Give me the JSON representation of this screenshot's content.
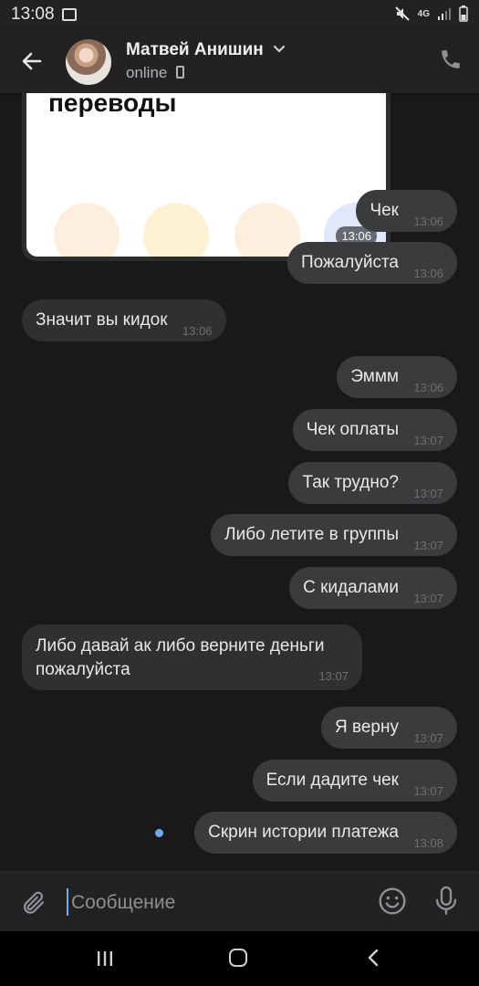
{
  "status_bar": {
    "time": "13:08",
    "network": "4G"
  },
  "header": {
    "name": "Матвей Анишин",
    "status": "online"
  },
  "preview_card": {
    "title": "переводы",
    "time": "13:06"
  },
  "messages": [
    {
      "text": "Чек",
      "time": "13:06"
    },
    {
      "text": "Пожалуйста",
      "time": "13:06"
    },
    {
      "text": "Значит вы кидок",
      "time": "13:06"
    },
    {
      "text": "Эммм",
      "time": "13:06"
    },
    {
      "text": "Чек оплаты",
      "time": "13:07"
    },
    {
      "text": "Так трудно?",
      "time": "13:07"
    },
    {
      "text": "Либо летите в группы",
      "time": "13:07"
    },
    {
      "text": "С кидалами",
      "time": "13:07"
    },
    {
      "text": "Либо давай ак либо верните деньги пожалуйста",
      "time": "13:07"
    },
    {
      "text": "Я верну",
      "time": "13:07"
    },
    {
      "text": "Если дадите чек",
      "time": "13:07"
    },
    {
      "text": "Скрин истории платежа",
      "time": "13:08"
    }
  ],
  "composer": {
    "placeholder": "Сообщение"
  },
  "colors": {
    "accent": "#71aaeb",
    "background": "#19191a",
    "bubble_out": "#3a3b3c",
    "bubble_in": "#2f3031"
  }
}
